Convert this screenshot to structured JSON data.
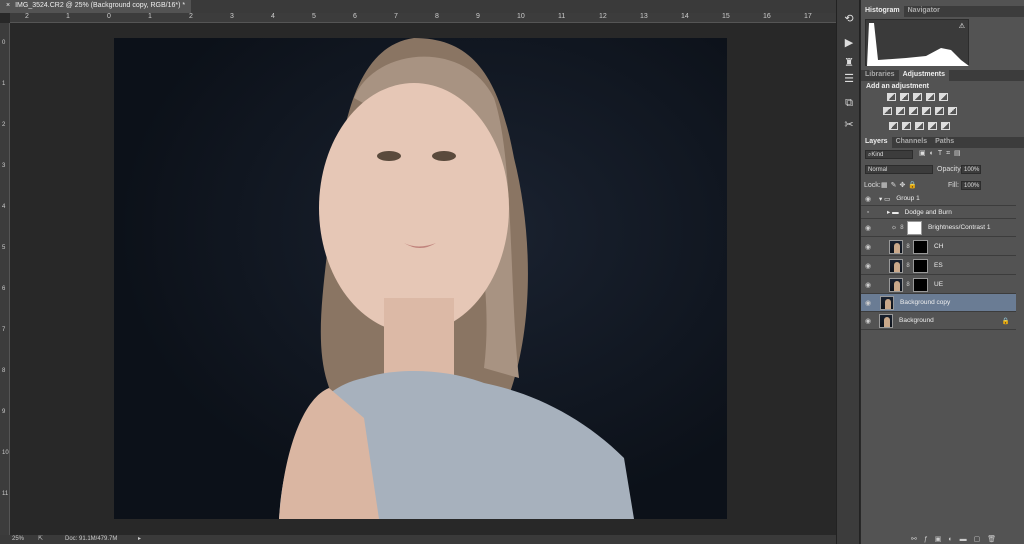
{
  "document": {
    "tab_title": "IMG_3524.CR2 @ 25% (Background copy, RGB/16*) *",
    "close": "×"
  },
  "rulers": {
    "top": [
      "2",
      "1",
      "0",
      "1",
      "2",
      "3",
      "4",
      "5",
      "6",
      "7",
      "8",
      "9",
      "10",
      "11",
      "12",
      "13",
      "14",
      "15",
      "16",
      "17"
    ],
    "left": [
      "0",
      "1",
      "2",
      "3",
      "4",
      "5",
      "6",
      "7",
      "8",
      "9",
      "10",
      "11"
    ]
  },
  "status": {
    "zoom": "25%",
    "doc": "Doc: 91.1M/479.7M"
  },
  "histogram_panel": {
    "tabs": [
      "Histogram",
      "Navigator"
    ],
    "warning": "⚠"
  },
  "adjustments_panel": {
    "tabs": [
      "Libraries",
      "Adjustments"
    ],
    "heading": "Add an adjustment"
  },
  "layers_panel": {
    "tabs": [
      "Layers",
      "Channels",
      "Paths"
    ],
    "filter": "Kind",
    "blend_mode": "Normal",
    "opacity_label": "Opacity:",
    "opacity": "100%",
    "lock_label": "Lock:",
    "fill_label": "Fill:",
    "fill": "100%",
    "layers": [
      {
        "name": "Group 1",
        "visible": true,
        "type": "group"
      },
      {
        "name": "Dodge and Burn",
        "visible": false,
        "type": "group"
      },
      {
        "name": "Brightness/Contrast 1",
        "visible": true,
        "type": "adjustment"
      },
      {
        "name": "CH",
        "visible": true,
        "type": "masked"
      },
      {
        "name": "ES",
        "visible": true,
        "type": "masked"
      },
      {
        "name": "UE",
        "visible": true,
        "type": "masked"
      },
      {
        "name": "Background copy",
        "visible": true,
        "type": "pixel",
        "selected": true
      },
      {
        "name": "Background",
        "visible": true,
        "type": "locked"
      }
    ]
  },
  "colors": {
    "selected_layer": "#6a7c94",
    "panel": "#535353",
    "canvas_bg": "#282828"
  }
}
